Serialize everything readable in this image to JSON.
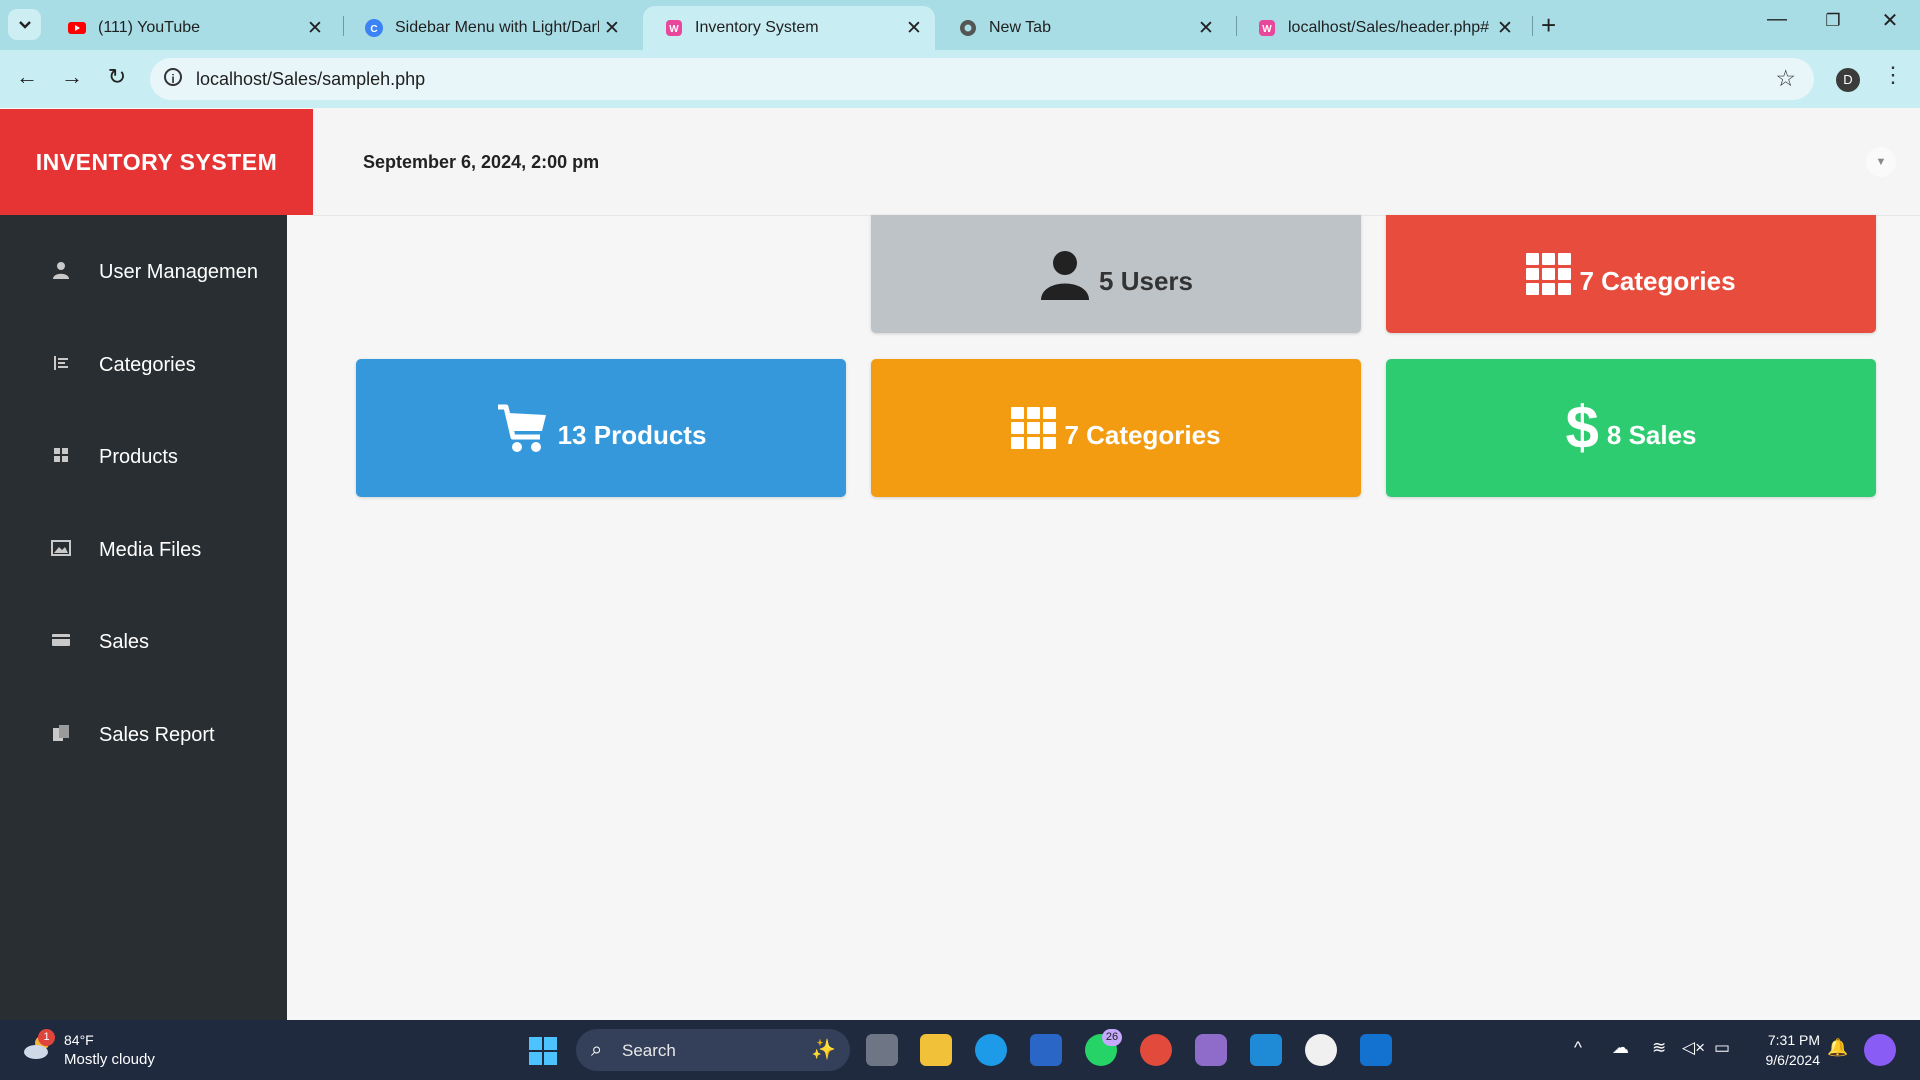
{
  "browser": {
    "tabs": [
      {
        "title": "(111) YouTube",
        "active": false
      },
      {
        "title": "Sidebar Menu with Light/Dark T",
        "active": false
      },
      {
        "title": "Inventory System",
        "active": true
      },
      {
        "title": "New Tab",
        "active": false
      },
      {
        "title": "localhost/Sales/header.php#",
        "active": false
      }
    ],
    "url": "localhost/Sales/sampleh.php",
    "profile_initial": "D"
  },
  "app": {
    "brand": "INVENTORY SYSTEM",
    "datetime": "September 6, 2024, 2:00 pm",
    "sidebar": [
      {
        "label": "User Managemen",
        "icon": "user-icon"
      },
      {
        "label": "Categories",
        "icon": "indent-icon"
      },
      {
        "label": "Products",
        "icon": "grid-icon"
      },
      {
        "label": "Media Files",
        "icon": "image-icon"
      },
      {
        "label": "Sales",
        "icon": "credit-card-icon"
      },
      {
        "label": "Sales Report",
        "icon": "report-icon"
      }
    ],
    "cards": {
      "users": {
        "value": "5",
        "label": "Users",
        "color": "#bec3c8"
      },
      "categories_top": {
        "value": "7",
        "label": "Categories",
        "color": "#e74c3c"
      },
      "products": {
        "value": "13",
        "label": "Products",
        "color": "#3498db"
      },
      "categories": {
        "value": "7",
        "label": "Categories",
        "color": "#f39c12"
      },
      "sales": {
        "value": "8",
        "label": "Sales",
        "color": "#2ecc71"
      }
    }
  },
  "taskbar": {
    "weather": {
      "temp": "84°F",
      "desc": "Mostly cloudy",
      "badge": "1"
    },
    "search_label": "Search",
    "whatsapp_badge": "26",
    "time": "7:31 PM",
    "date": "9/6/2024"
  }
}
